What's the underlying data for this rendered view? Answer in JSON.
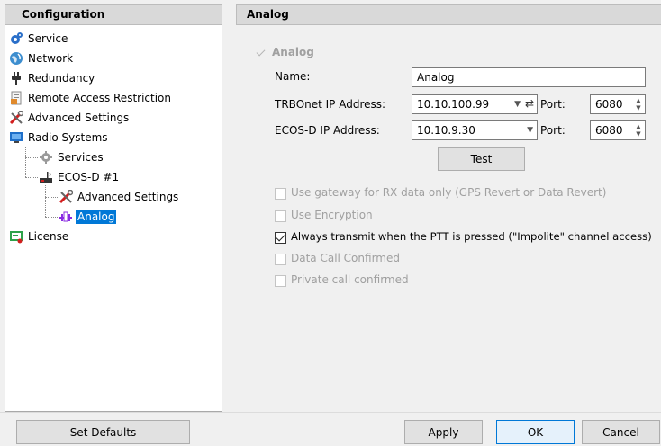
{
  "left": {
    "header": "Configuration",
    "tree": [
      {
        "label": "Service",
        "icon": "gear-icon"
      },
      {
        "label": "Network",
        "icon": "globe-icon"
      },
      {
        "label": "Redundancy",
        "icon": "plug-icon"
      },
      {
        "label": "Remote Access Restriction",
        "icon": "document-icon"
      },
      {
        "label": "Advanced Settings",
        "icon": "tools-icon"
      },
      {
        "label": "Radio Systems",
        "icon": "monitor-icon"
      },
      {
        "label": "Services",
        "icon": "gear-icon"
      },
      {
        "label": "ECOS-D #1",
        "icon": "radio-icon"
      },
      {
        "label": "Advanced Settings",
        "icon": "tools-icon"
      },
      {
        "label": "Analog",
        "icon": "connector-icon"
      },
      {
        "label": "License",
        "icon": "license-icon"
      }
    ],
    "set_defaults": "Set Defaults"
  },
  "right": {
    "header": "Analog",
    "analog_checkbox": "Analog",
    "name_label": "Name:",
    "name_value": "Analog",
    "trbonet_label": "TRBOnet IP Address:",
    "trbonet_value": "10.10.100.99",
    "ecos_label": "ECOS-D IP Address:",
    "ecos_value": "10.10.9.30",
    "port_label": "Port:",
    "port1_value": "6080",
    "port2_value": "6080",
    "test_button": "Test",
    "options": [
      {
        "label": "Use gateway for RX data only (GPS Revert or Data Revert)",
        "checked": false,
        "enabled": false
      },
      {
        "label": "Use Encryption",
        "checked": false,
        "enabled": false
      },
      {
        "label": "Always transmit when the PTT is pressed (\"Impolite\" channel access)",
        "checked": true,
        "enabled": true
      },
      {
        "label": "Data Call Confirmed",
        "checked": false,
        "enabled": false
      },
      {
        "label": "Private call confirmed",
        "checked": false,
        "enabled": false
      }
    ]
  },
  "buttons": {
    "apply": "Apply",
    "ok": "OK",
    "cancel": "Cancel"
  },
  "colors": {
    "selection": "#0078d7",
    "header_bg": "#d9d9d9"
  }
}
